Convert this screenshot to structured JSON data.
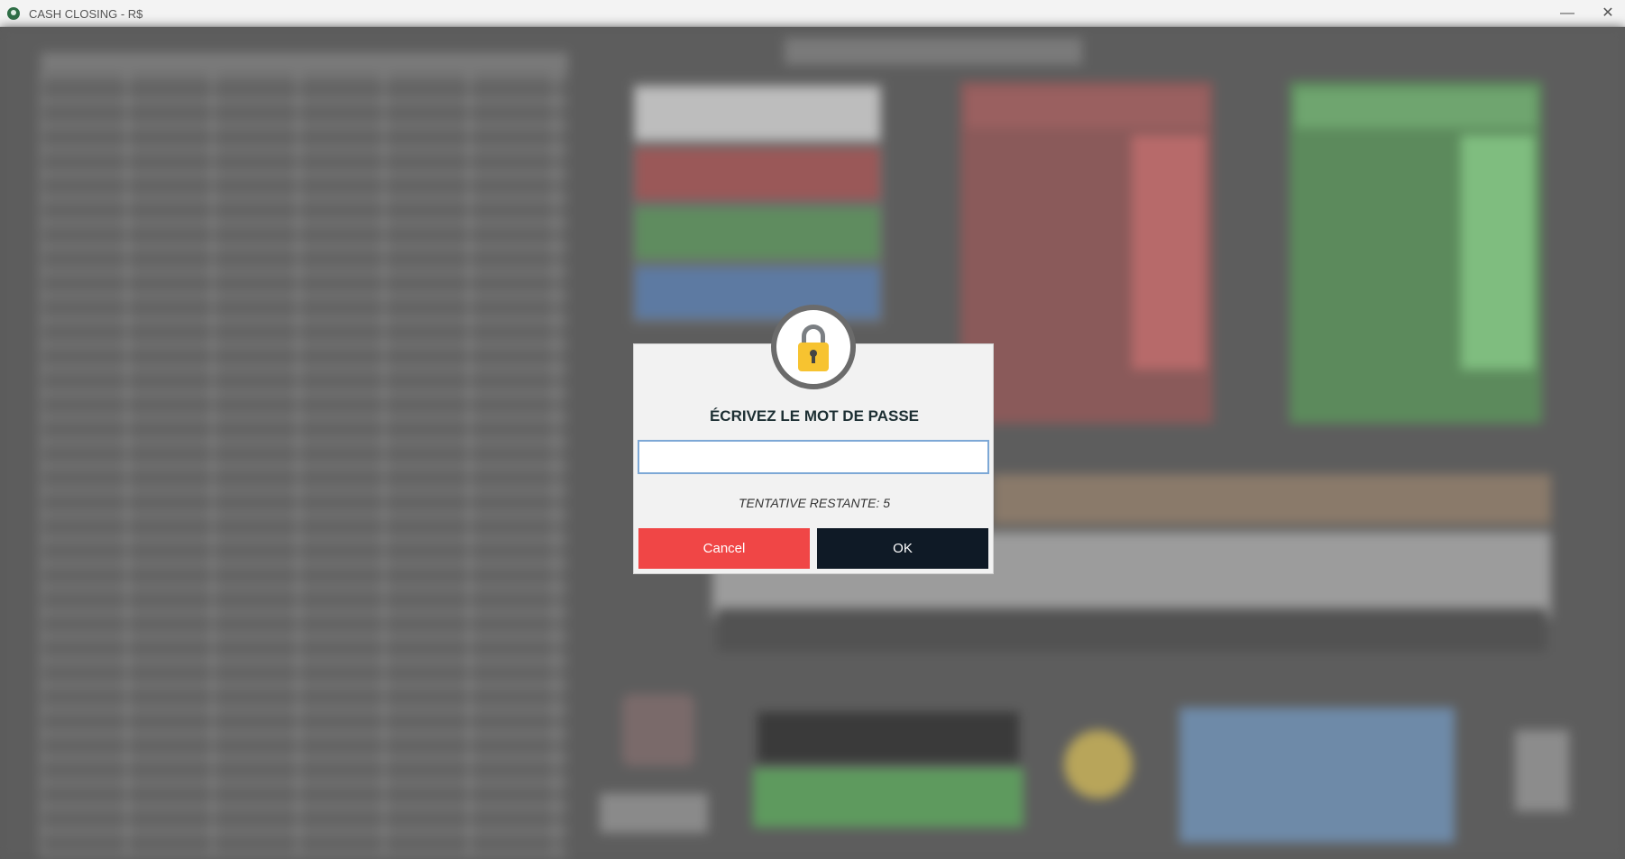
{
  "window": {
    "title": "CASH CLOSING - R$",
    "minimize_glyph": "—",
    "close_glyph": "✕",
    "icon": "app-download-icon"
  },
  "dialog": {
    "icon": "lock-icon",
    "title": "ÉCRIVEZ LE MOT DE PASSE",
    "password_value": "",
    "attempts_text": "TENTATIVE RESTANTE: 5",
    "cancel_label": "Cancel",
    "ok_label": "OK"
  },
  "colors": {
    "cancel": "#f04646",
    "ok": "#0f1a26",
    "lock": "#f7c330",
    "focus_border": "#7da8d6"
  }
}
